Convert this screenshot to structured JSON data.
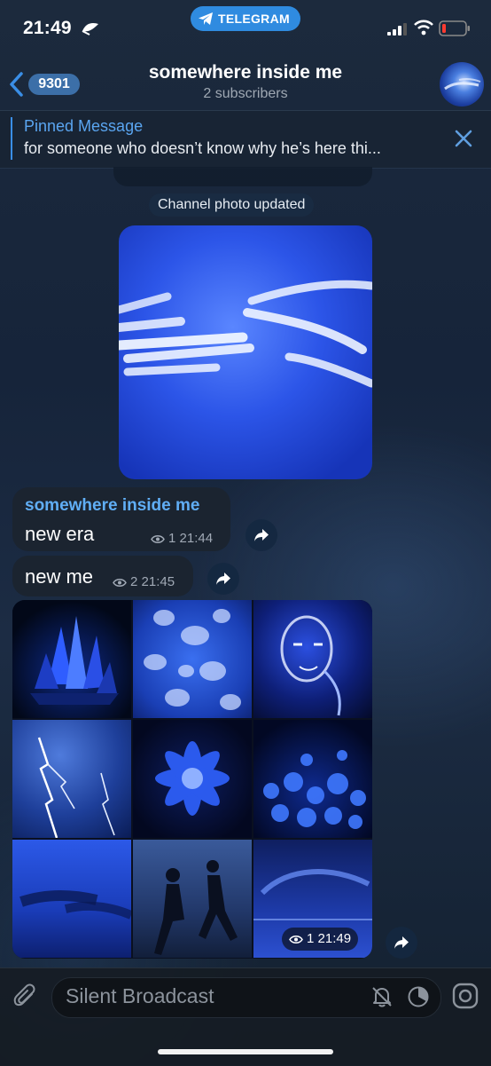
{
  "status_bar": {
    "time": "21:49",
    "pill_label": "TELEGRAM"
  },
  "header": {
    "back_count": "9301",
    "title": "somewhere inside me",
    "subtitle": "2 subscribers"
  },
  "pinned": {
    "label": "Pinned Message",
    "text": "for someone who doesn’t know why he’s here thi..."
  },
  "service_message": "Channel photo updated",
  "messages": [
    {
      "sender": "somewhere inside me",
      "text": "new era",
      "views": "1",
      "time": "21:44"
    },
    {
      "text": "new me",
      "views": "2",
      "time": "21:45"
    }
  ],
  "album": {
    "views": "1",
    "time": "21:49",
    "images": [
      "crystal",
      "jellyfish",
      "glowing-face",
      "lightning",
      "glowing-flower",
      "glowing-flowers-field",
      "hands-underwater",
      "couple-running",
      "aurora-sea"
    ]
  },
  "input": {
    "placeholder": "Silent Broadcast"
  },
  "colors": {
    "accent": "#2f8be0",
    "link": "#60aef5",
    "bubble": "#1b2430"
  }
}
